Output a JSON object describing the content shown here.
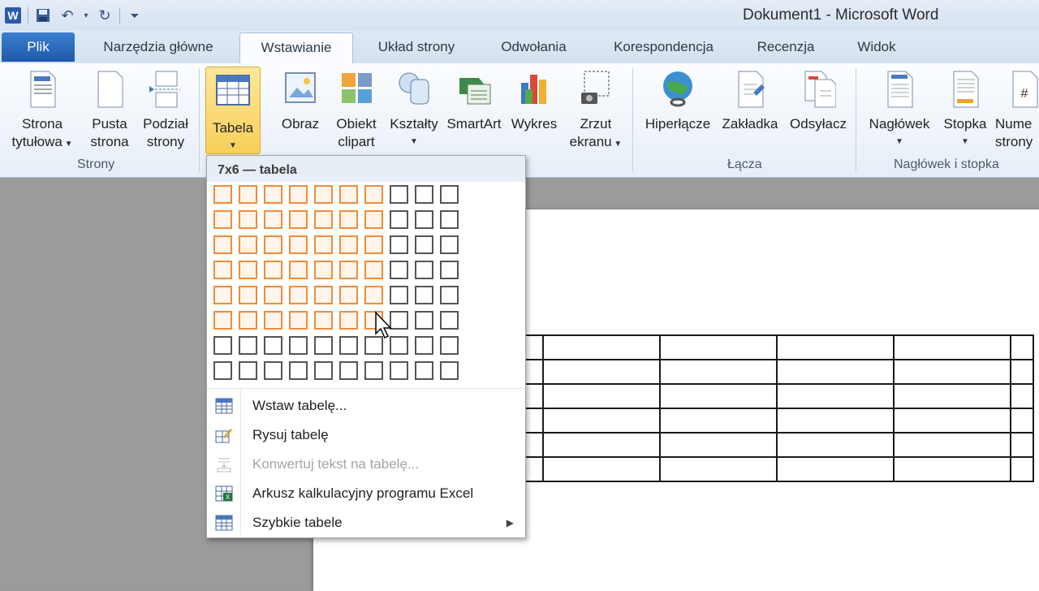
{
  "window": {
    "title": "Dokument1  -  Microsoft Word"
  },
  "quick_access": {
    "app_icon_letter": "W"
  },
  "tabs": [
    {
      "label": "Plik"
    },
    {
      "label": "Narzędzia główne"
    },
    {
      "label": "Wstawianie"
    },
    {
      "label": "Układ strony"
    },
    {
      "label": "Odwołania"
    },
    {
      "label": "Korespondencja"
    },
    {
      "label": "Recenzja"
    },
    {
      "label": "Widok"
    }
  ],
  "ribbon": {
    "groups": {
      "pages": "Strony",
      "links": "Łącza",
      "header_footer": "Nagłówek i stopka"
    },
    "buttons": {
      "cover_page": [
        "Strona",
        "tytułowa"
      ],
      "blank_page": [
        "Pusta",
        "strona"
      ],
      "page_break": [
        "Podział",
        "strony"
      ],
      "table": "Tabela",
      "picture": "Obraz",
      "clipart": [
        "Obiekt",
        "clipart"
      ],
      "shapes": "Kształty",
      "smartart": "SmartArt",
      "chart": "Wykres",
      "screenshot": [
        "Zrzut",
        "ekranu"
      ],
      "hyperlink": "Hiperłącze",
      "bookmark": "Zakładka",
      "cross_ref": "Odsyłacz",
      "header": "Nagłówek",
      "footer": "Stopka",
      "page_number": [
        "Nume",
        "strony"
      ]
    }
  },
  "table_menu": {
    "header": "7x6 — tabela",
    "grid_cols": 10,
    "grid_rows": 8,
    "selected_cols": 7,
    "selected_rows": 6,
    "items": [
      {
        "label": "Wstaw tabelę...",
        "enabled": true
      },
      {
        "label": "Rysuj tabelę",
        "enabled": true
      },
      {
        "label": "Konwertuj tekst na tabelę...",
        "enabled": false
      },
      {
        "label": "Arkusz kalkulacyjny programu Excel",
        "enabled": true
      },
      {
        "label": "Szybkie tabele",
        "enabled": true,
        "submenu": true
      }
    ]
  },
  "document": {
    "table_rows": 6
  },
  "colors": {
    "file_tab": "#2a6cc2",
    "selection_orange": "#f08c3a",
    "selected_button": "#f8cf5a"
  }
}
